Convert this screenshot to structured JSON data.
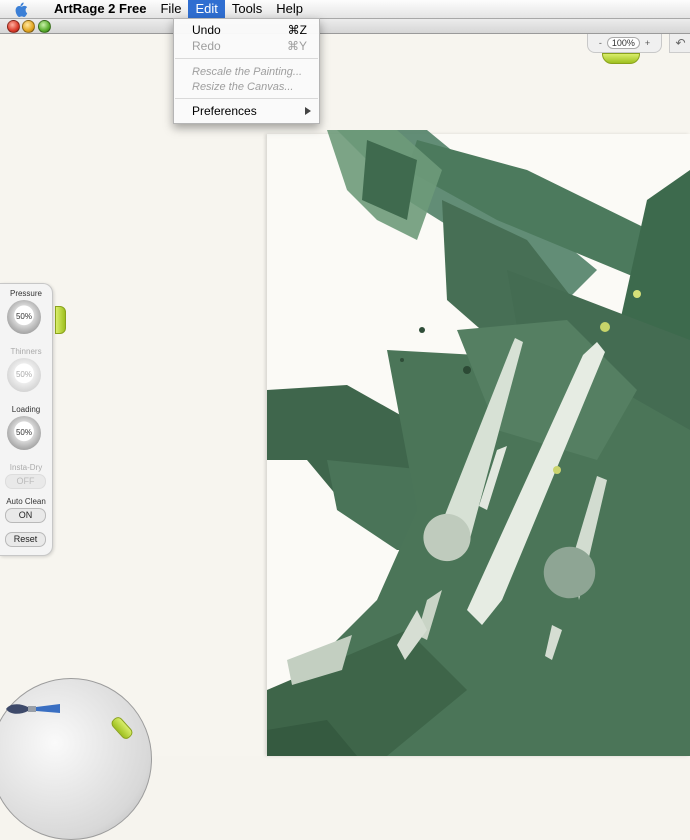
{
  "menubar": {
    "app_name": "ArtRage 2 Free",
    "items": [
      "File",
      "Edit",
      "Tools",
      "Help"
    ],
    "active_item": "Edit"
  },
  "edit_menu": {
    "undo": {
      "label": "Undo",
      "shortcut": "⌘Z"
    },
    "redo": {
      "label": "Redo",
      "shortcut": "⌘Y",
      "enabled": false
    },
    "rescale": {
      "label": "Rescale the Painting...",
      "enabled": false
    },
    "resize": {
      "label": "Resize the Canvas...",
      "enabled": false
    },
    "preferences": {
      "label": "Preferences",
      "has_submenu": true
    }
  },
  "zoom": {
    "minus": "-",
    "value": "100%",
    "plus": "+"
  },
  "settings": {
    "pressure": {
      "label": "Pressure",
      "value": "50%"
    },
    "thinners": {
      "label": "Thinners",
      "value": "50%",
      "enabled": false
    },
    "loading": {
      "label": "Loading",
      "value": "50%"
    },
    "insta_dry": {
      "label": "Insta-Dry",
      "value": "OFF",
      "enabled": false
    },
    "auto_clean": {
      "label": "Auto Clean",
      "value": "ON"
    },
    "reset": "Reset"
  },
  "colors": {
    "paint_green": "#4f7a5d",
    "paint_light": "#dfe6dd",
    "accent_grip": "#b5d432",
    "menu_highlight": "#2f6ed1"
  }
}
